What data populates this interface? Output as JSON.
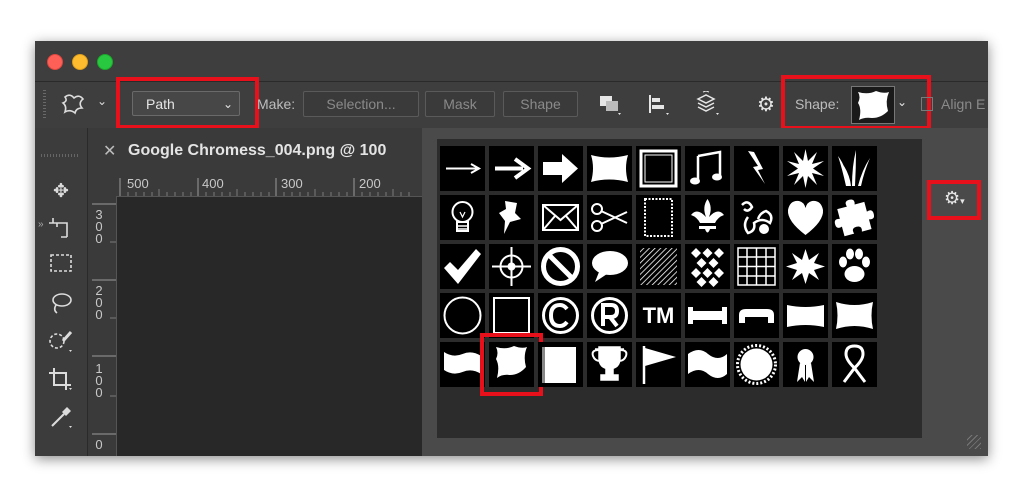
{
  "window": {
    "traffic_lights": [
      "close",
      "minimize",
      "zoom"
    ]
  },
  "options_bar": {
    "tool_icon": "custom-shape-icon",
    "mode": {
      "value": "Path",
      "options": [
        "Path"
      ]
    },
    "make_label": "Make:",
    "selection_label": "Selection...",
    "mask_label": "Mask",
    "shape_button_label": "Shape",
    "shape_label": "Shape:",
    "align_label": "Align E"
  },
  "document": {
    "tab_title": "Google Chromess_004.png @ 100",
    "ruler_h": [
      "500",
      "400",
      "300",
      "200"
    ],
    "ruler_v": [
      [
        "3",
        "0",
        "0"
      ],
      [
        "2",
        "0",
        "0"
      ],
      [
        "1",
        "0",
        "0"
      ],
      [
        "0"
      ]
    ]
  },
  "shape_picker": {
    "rows": [
      [
        "arrow-thin",
        "arrow-medium",
        "arrow-bold",
        "banner-rect",
        "frame-rough",
        "music-note",
        "lightning",
        "starburst",
        "grass"
      ],
      [
        "lightbulb",
        "thumbtack",
        "envelope",
        "scissors",
        "stamp-frame",
        "fleur-de-lis",
        "ornament",
        "heart",
        "puzzle-piece"
      ],
      [
        "checkmark",
        "crosshair",
        "no-sign",
        "speech-bubble",
        "hatched-square",
        "checker-diamond",
        "grid",
        "star-burst-2",
        "paw-print"
      ],
      [
        "circle-frame",
        "square-frame",
        "copyright",
        "registered",
        "trademark",
        "banner-1",
        "banner-2",
        "banner-3",
        "banner-4"
      ],
      [
        "banner-5",
        "sign-wave",
        "page",
        "trophy",
        "flag",
        "wave-flag",
        "seal",
        "ribbon-award",
        "awareness-ribbon"
      ]
    ],
    "selected": "sign-wave"
  },
  "trademark_text": "TM",
  "colors": {
    "highlight": "#e8111b",
    "window_bg": "#535353",
    "panel_bg": "#2c2c2c"
  }
}
